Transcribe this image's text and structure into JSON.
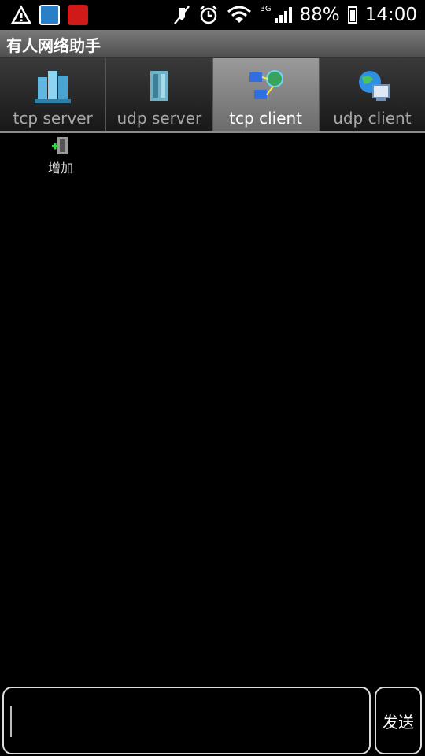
{
  "status_bar": {
    "battery": "88%",
    "time": "14:00",
    "network": "3G",
    "icons": [
      "warning-icon",
      "wifi-app-icon",
      "red-app-icon",
      "mute-icon",
      "alarm-icon",
      "wifi-icon",
      "signal-icon",
      "battery-icon"
    ]
  },
  "app": {
    "title": "有人网络助手"
  },
  "tabs": [
    {
      "label": "tcp server",
      "icon": "server-cluster-icon",
      "active": false
    },
    {
      "label": "udp server",
      "icon": "server-tower-icon",
      "active": false
    },
    {
      "label": "tcp client",
      "icon": "network-client-icon",
      "active": true
    },
    {
      "label": "udp client",
      "icon": "globe-computer-icon",
      "active": false
    }
  ],
  "main": {
    "add_label": "增加"
  },
  "footer": {
    "input_value": "",
    "send_label": "发送"
  }
}
